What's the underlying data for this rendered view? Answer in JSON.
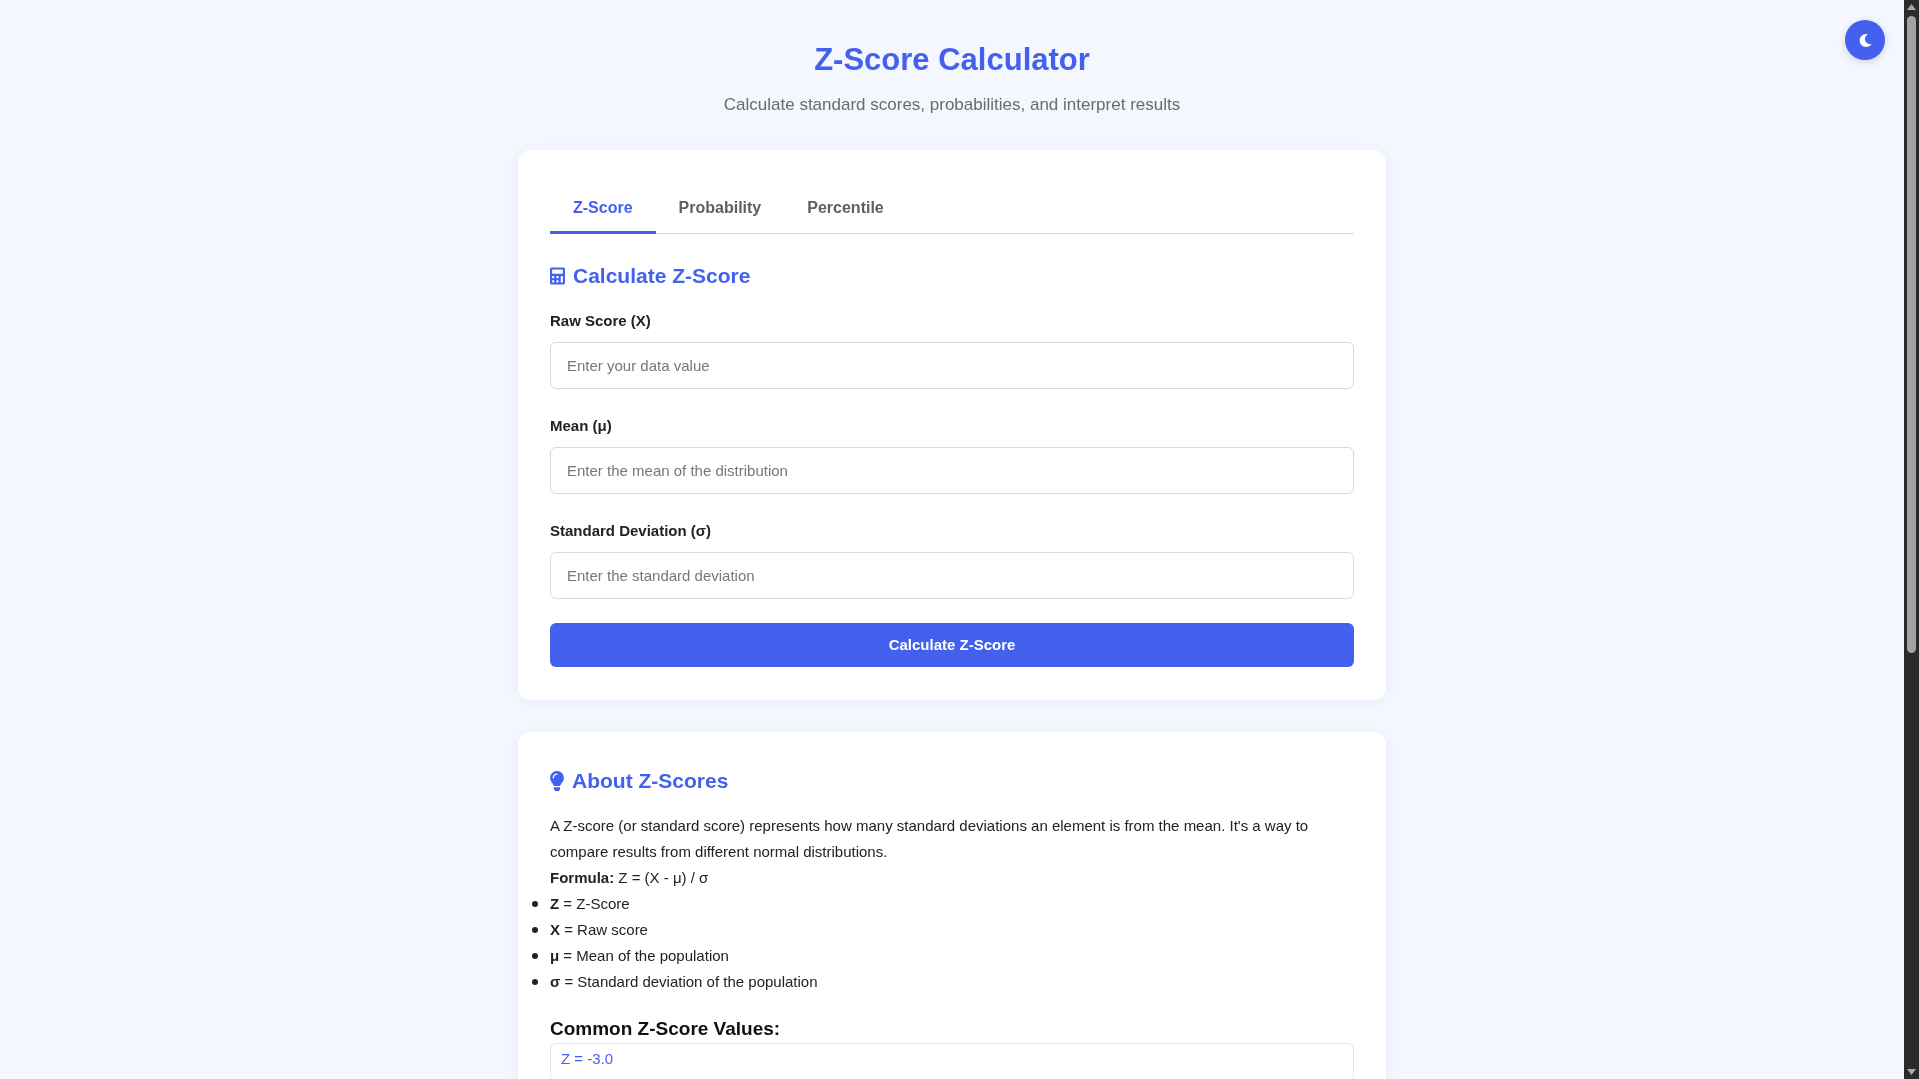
{
  "header": {
    "title": "Z-Score Calculator",
    "subtitle": "Calculate standard scores, probabilities, and interpret results"
  },
  "tabs": [
    {
      "label": "Z-Score",
      "selected": true
    },
    {
      "label": "Probability",
      "selected": false
    },
    {
      "label": "Percentile",
      "selected": false
    }
  ],
  "calculator": {
    "heading": "Calculate Z-Score",
    "fields": [
      {
        "label": "Raw Score (X)",
        "placeholder": "Enter your data value"
      },
      {
        "label": "Mean (μ)",
        "placeholder": "Enter the mean of the distribution"
      },
      {
        "label": "Standard Deviation (σ)",
        "placeholder": "Enter the standard deviation"
      }
    ],
    "button": "Calculate Z-Score"
  },
  "about": {
    "heading": "About Z-Scores",
    "paragraph": "A Z-score (or standard score) represents how many standard deviations an element is from the mean. It's a way to compare results from different normal distributions.",
    "formula": "**Formula:** Z = (X - μ) / σ",
    "definitions": [
      "**Z** = Z-Score",
      "**X** = Raw score",
      "**μ** = Mean of the population",
      "**σ** = Standard deviation of the population"
    ],
    "common_values": {
      "heading": "Common Z-Score Values:",
      "items": [
        "Z = -3.0"
      ]
    }
  }
}
